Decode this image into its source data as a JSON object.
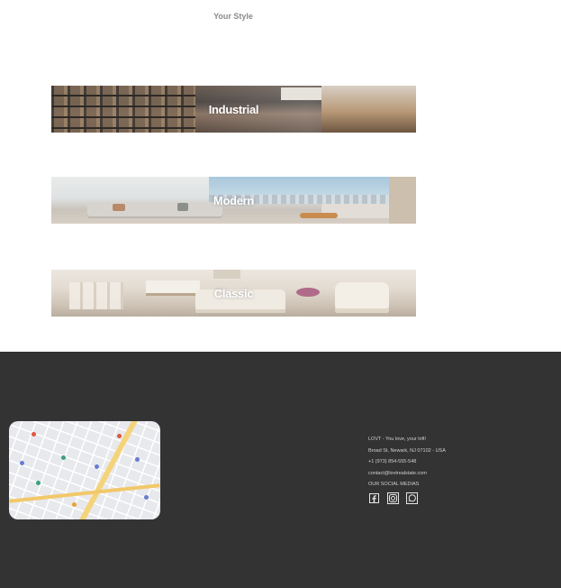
{
  "section": {
    "title": "Your Style"
  },
  "styles": [
    {
      "label": "Industrial"
    },
    {
      "label": "Modern"
    },
    {
      "label": "Classic"
    }
  ],
  "footer": {
    "tagline": "LOVT - You love, your loft!",
    "address": "Broad St, Newark, NJ 07102 - USA",
    "phone": "+1 (973) 854-555-548",
    "email": "contact@lovtrealstate.com",
    "social_heading": "OUR SOCIAL MEDIAS",
    "social_icons": [
      "facebook-icon",
      "instagram-icon",
      "whatsapp-icon"
    ]
  },
  "colors": {
    "footer_bg": "#333333",
    "heading": "#8a8a8a",
    "footer_text": "#cfcfcf"
  }
}
